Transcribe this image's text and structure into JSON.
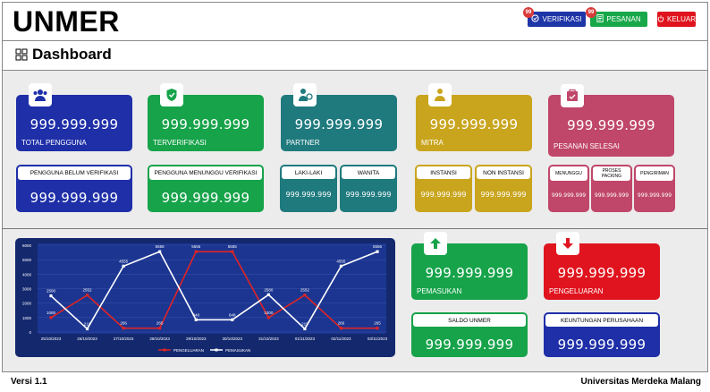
{
  "header": {
    "brand": "UNMER",
    "buttons": {
      "verifikasi": "VERIFIKASI",
      "pesanan": "PESANAN",
      "keluar": "KELUAR"
    },
    "badges": {
      "verifikasi": "99",
      "pesanan": "99"
    }
  },
  "page": {
    "title": "Dashboard"
  },
  "stats": {
    "total_pengguna": {
      "value": "999.999.999",
      "label": "TOTAL PENGGUNA"
    },
    "terverifikasi": {
      "value": "999.999.999",
      "label": "TERVERIFIKASI"
    },
    "partner": {
      "value": "999.999.999",
      "label": "PARTNER"
    },
    "mitra": {
      "value": "999.999.999",
      "label": "MITRA"
    },
    "pesanan_selesai": {
      "value": "999.999.999",
      "label": "PESANAN SELESAI"
    }
  },
  "sub": {
    "belum_verifikasi": {
      "label": "PENGGUNA BELUM VERIFIKASI",
      "value": "999.999.999"
    },
    "menunggu_verifikasi": {
      "label": "PENGGUNA MENUNGGU VERIFIKASI",
      "value": "999.999.999"
    },
    "laki": {
      "label": "LAKI-LAKI",
      "value": "999.999.999"
    },
    "wanita": {
      "label": "WANITA",
      "value": "999.999.999"
    },
    "instansi": {
      "label": "INSTANSI",
      "value": "999.999.999"
    },
    "non_instansi": {
      "label": "NON INSTANSI",
      "value": "999.999.999"
    },
    "menunggu": {
      "label": "MENUNGGU",
      "value": "999.999.999"
    },
    "proses": {
      "label": "PROSES PACKING",
      "value": "999.999.999"
    },
    "pengiriman": {
      "label": "PENGIRIMAN",
      "value": "999.999.999"
    }
  },
  "finance": {
    "pemasukan": {
      "value": "999.999.999",
      "label": "PEMASUKAN"
    },
    "pengeluaran": {
      "value": "999.999.999",
      "label": "PENGELUARAN"
    },
    "saldo": {
      "label": "SALDO UNMER",
      "value": "999.999.999"
    },
    "keuntungan": {
      "label": "KEUNTUNGAN PERUSAHAAN",
      "value": "999.999.999"
    }
  },
  "chart_data": {
    "type": "line",
    "categories": [
      "25/10/2023",
      "26/10/2023",
      "27/10/2023",
      "28/10/2023",
      "29/10/2023",
      "30/10/2023",
      "31/10/2023",
      "01/11/2023",
      "02/11/2023",
      "03/11/2023"
    ],
    "ylim": [
      0,
      6000
    ],
    "yticks": [
      "0",
      "1000",
      "2000",
      "3000",
      "4000",
      "5000",
      "6000"
    ],
    "series": [
      {
        "name": "PENGELUARAN",
        "color": "#e02424",
        "values": [
          1000,
          2552,
          266,
          265,
          5555,
          5555,
          1000,
          2552,
          266,
          265
        ]
      },
      {
        "name": "PEMASUKAN",
        "color": "#ffffff",
        "values": [
          2500,
          219,
          4555,
          5556,
          848,
          848,
          2580,
          219,
          4555,
          5556
        ]
      }
    ],
    "point_labels": {
      "PENGELUARAN": [
        "1000",
        "2552",
        "266",
        "265",
        "5555",
        "5555",
        "1000",
        "2552",
        "266",
        "265"
      ],
      "PEMASUKAN": [
        "2500",
        "219",
        "4555",
        "5556",
        "848",
        "848",
        "2580",
        "219",
        "4555",
        "5556"
      ]
    }
  },
  "footer": {
    "version": "Versi 1.1",
    "org": "Universitas Merdeka Malang"
  }
}
